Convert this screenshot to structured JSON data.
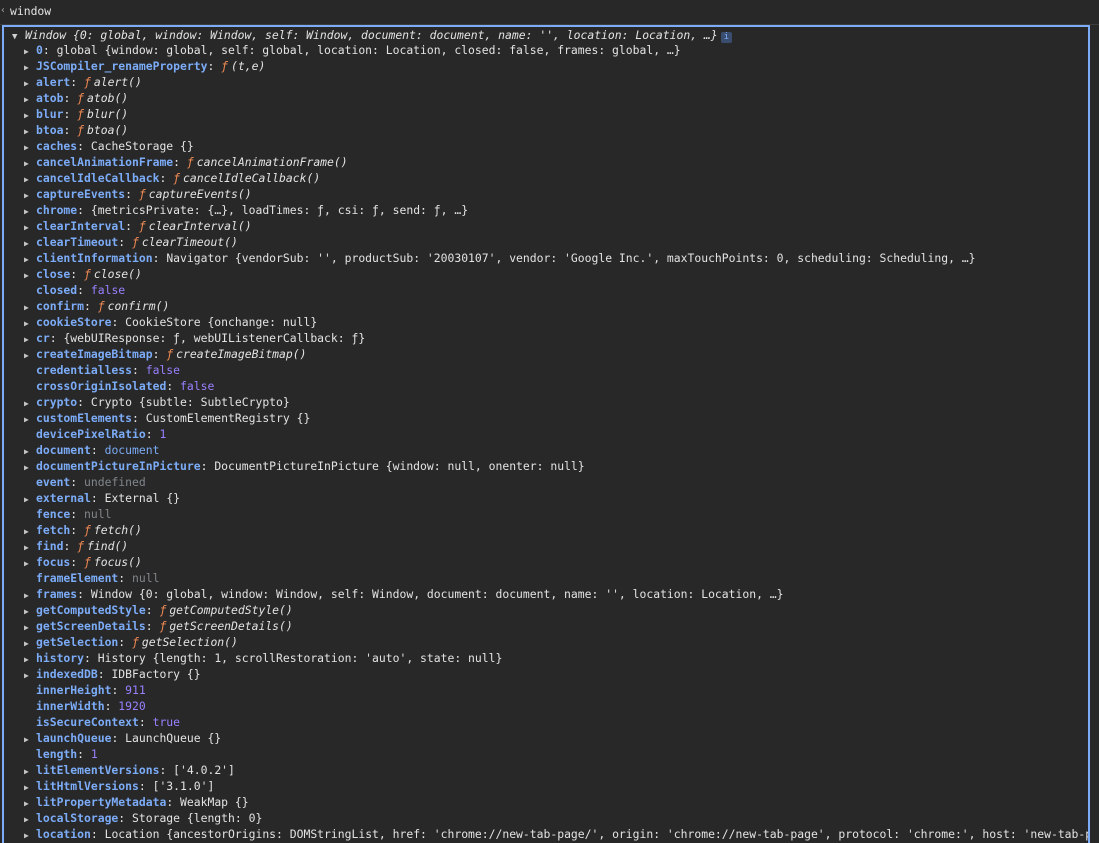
{
  "console": {
    "input_text": "window",
    "summary": "Window {0: global, window: Window, self: Window, document: document, name: '', location: Location, …}",
    "info_badge": "i"
  },
  "props": [
    {
      "key": "0",
      "expandable": true,
      "value": "global {window: global, self: global, location: Location, closed: false, frames: global, …}"
    },
    {
      "key": "JSCompiler_renameProperty",
      "expandable": true,
      "fn": "(t,e)"
    },
    {
      "key": "alert",
      "expandable": true,
      "fn": "alert()"
    },
    {
      "key": "atob",
      "expandable": true,
      "fn": "atob()"
    },
    {
      "key": "blur",
      "expandable": true,
      "fn": "blur()"
    },
    {
      "key": "btoa",
      "expandable": true,
      "fn": "btoa()"
    },
    {
      "key": "caches",
      "expandable": true,
      "value": "CacheStorage {}"
    },
    {
      "key": "cancelAnimationFrame",
      "expandable": true,
      "fn": "cancelAnimationFrame()"
    },
    {
      "key": "cancelIdleCallback",
      "expandable": true,
      "fn": "cancelIdleCallback()"
    },
    {
      "key": "captureEvents",
      "expandable": true,
      "fn": "captureEvents()"
    },
    {
      "key": "chrome",
      "expandable": true,
      "value": "{metricsPrivate: {…}, loadTimes: ƒ, csi: ƒ, send: ƒ, …}"
    },
    {
      "key": "clearInterval",
      "expandable": true,
      "fn": "clearInterval()"
    },
    {
      "key": "clearTimeout",
      "expandable": true,
      "fn": "clearTimeout()"
    },
    {
      "key": "clientInformation",
      "expandable": true,
      "value": "Navigator {vendorSub: '', productSub: '20030107', vendor: 'Google Inc.', maxTouchPoints: 0, scheduling: Scheduling, …}"
    },
    {
      "key": "close",
      "expandable": true,
      "fn": "close()"
    },
    {
      "key": "closed",
      "expandable": false,
      "value": "false",
      "vtype": "kw"
    },
    {
      "key": "confirm",
      "expandable": true,
      "fn": "confirm()"
    },
    {
      "key": "cookieStore",
      "expandable": true,
      "value": "CookieStore {onchange: null}"
    },
    {
      "key": "cr",
      "expandable": true,
      "value": "{webUIResponse: ƒ, webUIListenerCallback: ƒ}"
    },
    {
      "key": "createImageBitmap",
      "expandable": true,
      "fn": "createImageBitmap()"
    },
    {
      "key": "credentialless",
      "expandable": false,
      "value": "false",
      "vtype": "kw"
    },
    {
      "key": "crossOriginIsolated",
      "expandable": false,
      "value": "false",
      "vtype": "kw"
    },
    {
      "key": "crypto",
      "expandable": true,
      "value": "Crypto {subtle: SubtleCrypto}"
    },
    {
      "key": "customElements",
      "expandable": true,
      "value": "CustomElementRegistry {}"
    },
    {
      "key": "devicePixelRatio",
      "expandable": false,
      "value": "1",
      "vtype": "num"
    },
    {
      "key": "document",
      "expandable": true,
      "value": "document",
      "vtype": "link"
    },
    {
      "key": "documentPictureInPicture",
      "expandable": true,
      "value": "DocumentPictureInPicture {window: null, onenter: null}"
    },
    {
      "key": "event",
      "expandable": false,
      "value": "undefined",
      "vtype": "nul"
    },
    {
      "key": "external",
      "expandable": true,
      "value": "External {}"
    },
    {
      "key": "fence",
      "expandable": false,
      "value": "null",
      "vtype": "nul"
    },
    {
      "key": "fetch",
      "expandable": true,
      "fn": "fetch()"
    },
    {
      "key": "find",
      "expandable": true,
      "fn": "find()"
    },
    {
      "key": "focus",
      "expandable": true,
      "fn": "focus()"
    },
    {
      "key": "frameElement",
      "expandable": false,
      "value": "null",
      "vtype": "nul"
    },
    {
      "key": "frames",
      "expandable": true,
      "value": "Window {0: global, window: Window, self: Window, document: document, name: '', location: Location, …}"
    },
    {
      "key": "getComputedStyle",
      "expandable": true,
      "fn": "getComputedStyle()"
    },
    {
      "key": "getScreenDetails",
      "expandable": true,
      "fn": "getScreenDetails()"
    },
    {
      "key": "getSelection",
      "expandable": true,
      "fn": "getSelection()"
    },
    {
      "key": "history",
      "expandable": true,
      "value": "History {length: 1, scrollRestoration: 'auto', state: null}"
    },
    {
      "key": "indexedDB",
      "expandable": true,
      "value": "IDBFactory {}"
    },
    {
      "key": "innerHeight",
      "expandable": false,
      "value": "911",
      "vtype": "num"
    },
    {
      "key": "innerWidth",
      "expandable": false,
      "value": "1920",
      "vtype": "num"
    },
    {
      "key": "isSecureContext",
      "expandable": false,
      "value": "true",
      "vtype": "kw"
    },
    {
      "key": "launchQueue",
      "expandable": true,
      "value": "LaunchQueue {}"
    },
    {
      "key": "length",
      "expandable": false,
      "value": "1",
      "vtype": "num"
    },
    {
      "key": "litElementVersions",
      "expandable": true,
      "value": "['4.0.2']"
    },
    {
      "key": "litHtmlVersions",
      "expandable": true,
      "value": "['3.1.0']"
    },
    {
      "key": "litPropertyMetadata",
      "expandable": true,
      "value": "WeakMap {}"
    },
    {
      "key": "localStorage",
      "expandable": true,
      "value": "Storage {length: 0}"
    },
    {
      "key": "location",
      "expandable": true,
      "value": "Location {ancestorOrigins: DOMStringList, href: 'chrome://new-tab-page/', origin: 'chrome://new-tab-page', protocol: 'chrome:', host: 'new-tab-page', …}"
    }
  ]
}
